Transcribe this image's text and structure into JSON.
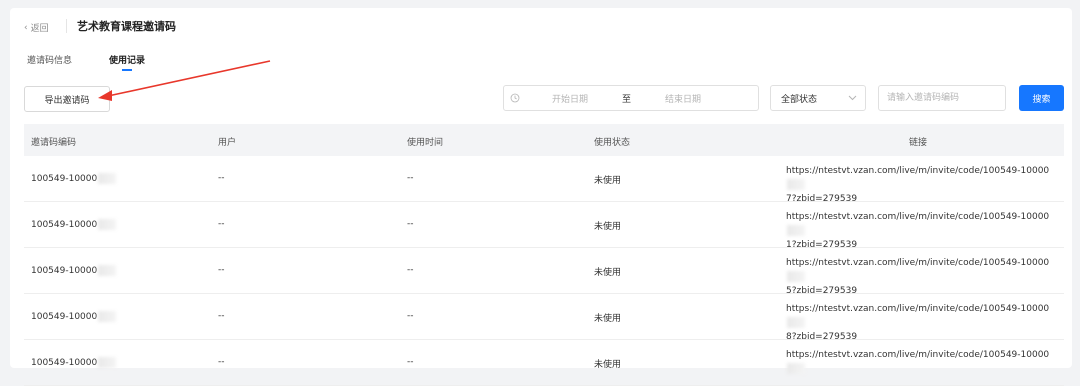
{
  "header": {
    "back_label": "返回",
    "title": "艺术教育课程邀请码"
  },
  "tabs": [
    {
      "label": "邀请码信息",
      "active": false
    },
    {
      "label": "使用记录",
      "active": true
    }
  ],
  "toolbar": {
    "export_label": "导出邀请码",
    "start_placeholder": "开始日期",
    "range_separator": "至",
    "end_placeholder": "结束日期",
    "status_selected": "全部状态",
    "code_placeholder": "请输入邀请码编码",
    "search_label": "搜索"
  },
  "colors": {
    "accent": "#1677ff",
    "arrow": "#e8372b"
  },
  "table": {
    "columns": [
      "邀请码编码",
      "用户",
      "使用时间",
      "使用状态",
      "链接"
    ],
    "rows": [
      {
        "code": "100549-10000",
        "user": "--",
        "time": "--",
        "status": "未使用",
        "link_line1": "https://ntestvt.vzan.com/live/m/invite/code/100549-10000",
        "link_line2": "7?zbid=279539"
      },
      {
        "code": "100549-10000",
        "user": "--",
        "time": "--",
        "status": "未使用",
        "link_line1": "https://ntestvt.vzan.com/live/m/invite/code/100549-10000",
        "link_line2": "1?zbid=279539"
      },
      {
        "code": "100549-10000",
        "user": "--",
        "time": "--",
        "status": "未使用",
        "link_line1": "https://ntestvt.vzan.com/live/m/invite/code/100549-10000",
        "link_line2": "5?zbid=279539"
      },
      {
        "code": "100549-10000",
        "user": "--",
        "time": "--",
        "status": "未使用",
        "link_line1": "https://ntestvt.vzan.com/live/m/invite/code/100549-10000",
        "link_line2": "8?zbid=279539"
      },
      {
        "code": "100549-10000",
        "user": "--",
        "time": "--",
        "status": "未使用",
        "link_line1": "https://ntestvt.vzan.com/live/m/invite/code/100549-10000",
        "link_line2": ""
      }
    ]
  }
}
